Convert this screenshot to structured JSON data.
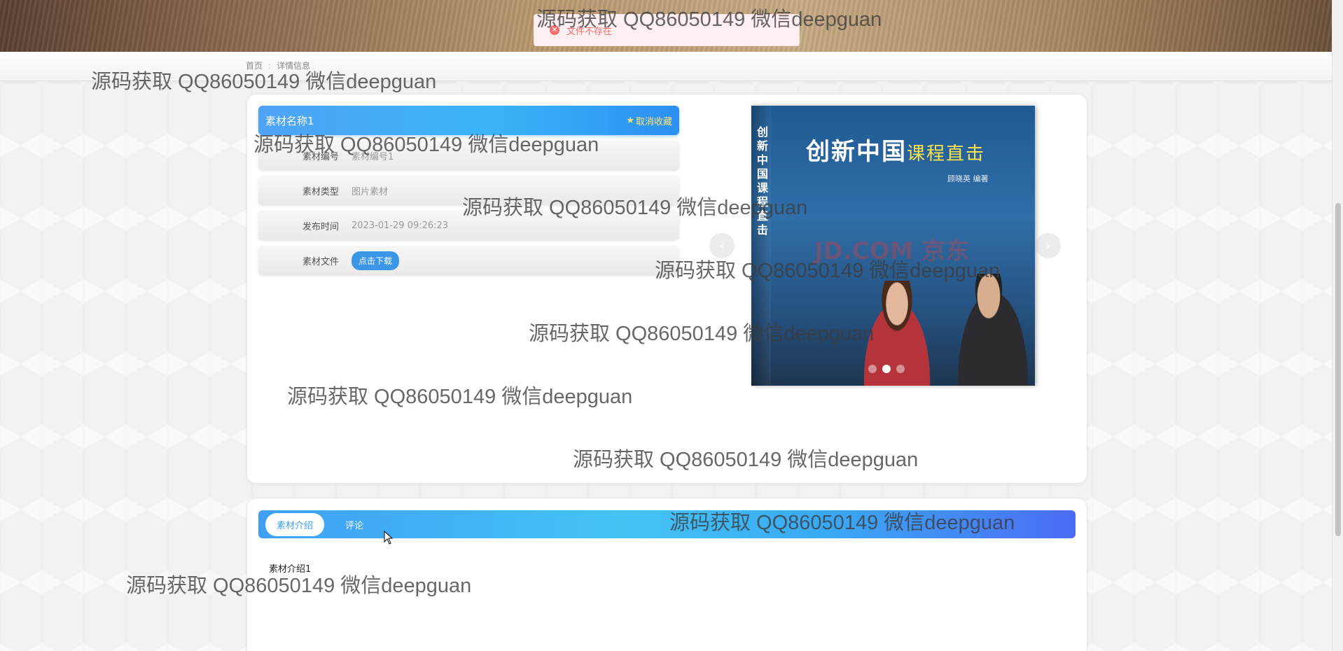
{
  "toast": {
    "message": "文件不存在",
    "icon": "error-circle-icon"
  },
  "breadcrumb": {
    "home": "首页",
    "separator": ":",
    "current": "详情信息"
  },
  "detail": {
    "title": "素材名称1",
    "favorite_label": "取消收藏",
    "rows": [
      {
        "label": "素材编号",
        "value": "素材编号1"
      },
      {
        "label": "素材类型",
        "value": "图片素材"
      },
      {
        "label": "发布时间",
        "value": "2023-01-29 09:26:23"
      }
    ],
    "file_label": "素材文件",
    "download_label": "点击下载"
  },
  "carousel": {
    "book_title_main": "创新中国",
    "book_title_sub": "课程直击",
    "book_vertical": "创新中国课程直击",
    "book_author": "顾晓英  编著",
    "overlay_mark": "JD.COM 京东",
    "prev_arrow": "‹",
    "next_arrow": "›",
    "slide_count": 3,
    "active_slide": 2
  },
  "tabs": {
    "items": [
      {
        "label": "素材介绍",
        "active": true
      },
      {
        "label": "评论",
        "active": false
      }
    ],
    "content": "素材介绍1"
  },
  "watermark": "源码获取 QQ86050149 微信deepguan"
}
